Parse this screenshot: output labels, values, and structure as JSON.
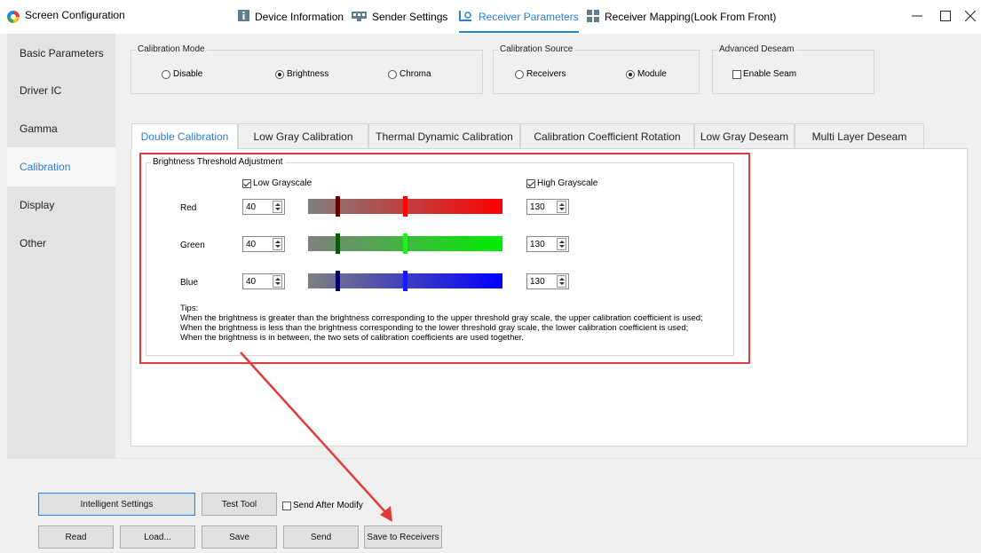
{
  "window": {
    "title": "Screen Configuration",
    "controls": [
      "minimize-icon",
      "maximize-icon",
      "close-icon"
    ]
  },
  "topnav": [
    {
      "label": "Device Information",
      "icon": "info-icon"
    },
    {
      "label": "Sender Settings",
      "icon": "sender-icon"
    },
    {
      "label": "Receiver Parameters",
      "icon": "receiver-icon",
      "active": true
    },
    {
      "label": "Receiver Mapping(Look From Front)",
      "icon": "mapping-icon"
    }
  ],
  "sidebar": {
    "items": [
      {
        "label": "Basic Parameters"
      },
      {
        "label": "Driver IC"
      },
      {
        "label": "Gamma"
      },
      {
        "label": "Calibration",
        "active": true
      },
      {
        "label": "Display"
      },
      {
        "label": "Other"
      }
    ]
  },
  "calibration_mode": {
    "title": "Calibration Mode",
    "options": [
      "Disable",
      "Brightness",
      "Chroma"
    ],
    "selected": "Brightness"
  },
  "calibration_source": {
    "title": "Calibration Source",
    "options": [
      "Receivers",
      "Module"
    ],
    "selected": "Module"
  },
  "advanced_deseam": {
    "title": "Advanced Deseam",
    "enable_seam_label": "Enable Seam",
    "enable_seam_checked": false
  },
  "tabs": [
    {
      "label": "Double Calibration",
      "active": true
    },
    {
      "label": "Low Gray Calibration"
    },
    {
      "label": "Thermal Dynamic Calibration"
    },
    {
      "label": "Calibration Coefficient Rotation"
    },
    {
      "label": "Low Gray Deseam"
    },
    {
      "label": "Multi Layer Deseam"
    }
  ],
  "brightness_threshold": {
    "title": "Brightness Threshold Adjustment",
    "low_grayscale_label": "Low Grayscale",
    "low_grayscale_checked": true,
    "high_grayscale_label": "High Grayscale",
    "high_grayscale_checked": true,
    "channels": [
      {
        "label": "Red",
        "low": "40",
        "high": "130",
        "color": "#ff0000",
        "low_handle_color": "#6b0000"
      },
      {
        "label": "Green",
        "low": "40",
        "high": "130",
        "color": "#00ee00",
        "low_handle_color": "#0a5a0a"
      },
      {
        "label": "Blue",
        "low": "40",
        "high": "130",
        "color": "#0000ff",
        "low_handle_color": "#00006b"
      }
    ],
    "tips": [
      "Tips:",
      "When the brightness is greater than the brightness corresponding to the upper threshold gray scale, the upper calibration coefficient is used;",
      "When the brightness is less than the brightness corresponding to the lower threshold gray scale, the lower calibration coefficient is used;",
      "When the brightness is in between, the two sets of calibration coefficients are used together."
    ]
  },
  "bottom": {
    "intelligent_settings": "Intelligent Settings",
    "test_tool": "Test Tool",
    "send_after_modify": "Send After Modify",
    "send_after_modify_checked": false,
    "read": "Read",
    "load": "Load...",
    "save": "Save",
    "send": "Send",
    "save_to_receivers": "Save to Receivers"
  },
  "colors": {
    "accent": "#2b7fd6",
    "annotation": "#e23b3b"
  }
}
